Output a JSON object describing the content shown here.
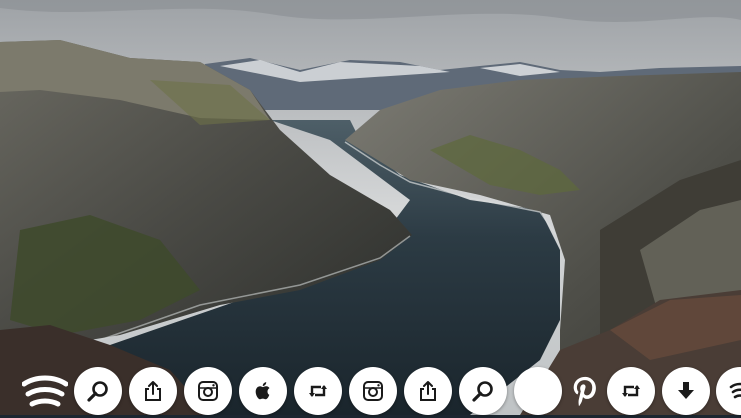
{
  "colors": {
    "sky": "#c8cbcd",
    "water": "#233038",
    "cliff": "#4a4a46",
    "moss": "#55613a",
    "button_bg": "#ffffff",
    "icon": "#1a1a1a"
  },
  "scene": {
    "description_icon": "fjord-landscape-photo"
  },
  "share_bar": {
    "items": [
      {
        "icon": "feed-icon"
      },
      {
        "icon": "search-icon"
      },
      {
        "icon": "share-icon"
      },
      {
        "icon": "instagram-icon"
      },
      {
        "icon": "apple-icon"
      },
      {
        "icon": "retweet-icon"
      },
      {
        "icon": "instagram-icon"
      },
      {
        "icon": "share-icon"
      },
      {
        "icon": "search-icon"
      },
      {
        "icon": "blank-icon"
      },
      {
        "icon": "pinterest-icon"
      },
      {
        "icon": "retweet-icon"
      },
      {
        "icon": "download-icon"
      },
      {
        "icon": "feed-icon"
      }
    ]
  }
}
